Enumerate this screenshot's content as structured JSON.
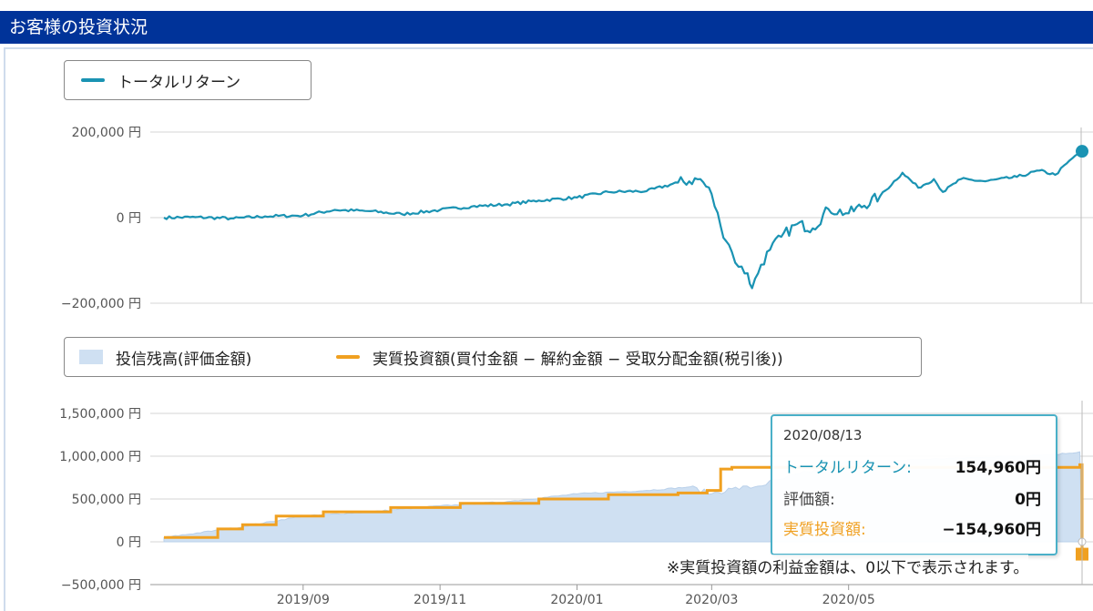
{
  "header": {
    "title": "お客様の投資状況"
  },
  "colors": {
    "header_bg": "#003399",
    "total_return": "#1a93b3",
    "investment": "#f0a020",
    "balance_fill": "#cfe0f2"
  },
  "legend_top": {
    "total_return_label": "トータルリターン"
  },
  "legend_bottom": {
    "balance_label": "投信残高(評価金額)",
    "investment_label": "実質投資額(買付金額 − 解約金額 − 受取分配金額(税引後))"
  },
  "tooltip": {
    "date": "2020/08/13",
    "total_return_label": "トータルリターン:",
    "total_return_value": "154,960円",
    "valuation_label": "評価額:",
    "valuation_value": "0円",
    "investment_label": "実質投資額:",
    "investment_value": "−154,960円"
  },
  "note": "※実質投資額の利益金額は、0以下で表示されます。",
  "chart_data": [
    {
      "type": "line",
      "series": [
        {
          "name": "トータルリターン",
          "x": [
            "2019/07/01",
            "2019/07/15",
            "2019/08/01",
            "2019/08/15",
            "2019/09/01",
            "2019/09/15",
            "2019/10/01",
            "2019/10/15",
            "2019/11/01",
            "2019/11/15",
            "2019/12/01",
            "2019/12/15",
            "2020/01/01",
            "2020/01/15",
            "2020/02/01",
            "2020/02/15",
            "2020/02/25",
            "2020/03/01",
            "2020/03/05",
            "2020/03/10",
            "2020/03/13",
            "2020/03/17",
            "2020/03/19",
            "2020/03/23",
            "2020/03/27",
            "2020/04/01",
            "2020/04/08",
            "2020/04/15",
            "2020/04/22",
            "2020/05/01",
            "2020/05/15",
            "2020/05/25",
            "2020/06/01",
            "2020/06/08",
            "2020/06/12",
            "2020/06/20",
            "2020/07/01",
            "2020/07/15",
            "2020/07/25",
            "2020/08/01",
            "2020/08/10",
            "2020/08/13"
          ],
          "values": [
            0,
            1000,
            -2000,
            3000,
            5000,
            18000,
            15000,
            8000,
            18000,
            26000,
            31000,
            40000,
            47000,
            60000,
            62000,
            82000,
            90000,
            55000,
            -20000,
            -80000,
            -115000,
            -130000,
            -165000,
            -110000,
            -75000,
            -45000,
            -15000,
            -25000,
            20000,
            10000,
            50000,
            105000,
            70000,
            90000,
            60000,
            90000,
            85000,
            95000,
            110000,
            100000,
            145000,
            154960
          ]
        }
      ],
      "yticks": [
        "200,000 円",
        "0 円",
        "−200,000 円"
      ],
      "ylim": [
        -200000,
        200000
      ]
    },
    {
      "type": "area",
      "x": [
        "2019/09",
        "2019/11",
        "2020/01",
        "2020/03",
        "2020/05"
      ],
      "series": [
        {
          "name": "投信残高(評価金額)",
          "type": "area",
          "x": [
            "2019/07/01",
            "2019/08/01",
            "2019/09/01",
            "2019/10/01",
            "2019/11/01",
            "2019/12/01",
            "2020/01/01",
            "2020/02/01",
            "2020/02/20",
            "2020/03/01",
            "2020/03/10",
            "2020/03/20",
            "2020/04/01",
            "2020/05/01",
            "2020/06/01",
            "2020/07/01",
            "2020/08/01",
            "2020/08/12",
            "2020/08/13"
          ],
          "values": [
            50000,
            160000,
            300000,
            350000,
            420000,
            470000,
            560000,
            600000,
            640000,
            560000,
            620000,
            640000,
            730000,
            930000,
            960000,
            990000,
            1020000,
            1050000,
            0
          ]
        },
        {
          "name": "実質投資額(買付金額 − 解約金額 − 受取分配金額(税引後))",
          "type": "step",
          "x": [
            "2019/07/01",
            "2019/07/25",
            "2019/08/05",
            "2019/08/20",
            "2019/09/10",
            "2019/10/10",
            "2019/11/10",
            "2019/12/15",
            "2020/01/15",
            "2020/02/15",
            "2020/02/28",
            "2020/03/05",
            "2020/03/10",
            "2020/08/12",
            "2020/08/13"
          ],
          "values": [
            50000,
            150000,
            200000,
            300000,
            350000,
            400000,
            450000,
            500000,
            550000,
            570000,
            600000,
            850000,
            870000,
            900000,
            -154960
          ]
        }
      ],
      "yticks": [
        "1,500,000 円",
        "1,000,000 円",
        "500,000 円",
        "0 円",
        "−500,000 円"
      ],
      "ylim": [
        -500000,
        1500000
      ]
    }
  ]
}
